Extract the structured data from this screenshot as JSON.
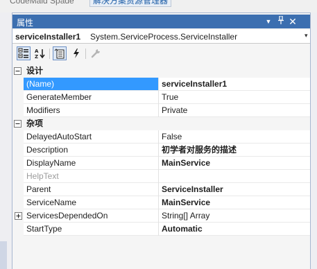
{
  "doc_tabs": [
    {
      "label": "CodeMaid Spade"
    },
    {
      "label": "解决方案资源管理器"
    }
  ],
  "panel": {
    "title": "属性",
    "buttons": {
      "dropdown": "▼",
      "pin": "ᚁ",
      "close": "✕"
    }
  },
  "selector": {
    "object_name": "serviceInstaller1",
    "object_type": "System.ServiceProcess.ServiceInstaller",
    "dropdown_glyph": "▾"
  },
  "toolbar": {
    "categorized": {
      "icon": "categorized-icon",
      "active": true
    },
    "alphabetical": {
      "icon": "alphabetical-sort-icon",
      "active": false
    },
    "properties": {
      "icon": "properties-icon",
      "active": true
    },
    "events": {
      "icon": "events-lightning-icon",
      "active": false
    },
    "property_pages": {
      "icon": "wrench-icon",
      "enabled": false
    }
  },
  "categories": [
    {
      "label": "设计",
      "expanded": true,
      "properties": [
        {
          "name": "(Name)",
          "value": "serviceInstaller1",
          "bold": true,
          "selected": true
        },
        {
          "name": "GenerateMember",
          "value": "True",
          "bold": false
        },
        {
          "name": "Modifiers",
          "value": "Private",
          "bold": false
        }
      ]
    },
    {
      "label": "杂项",
      "expanded": true,
      "properties": [
        {
          "name": "DelayedAutoStart",
          "value": "False",
          "bold": false
        },
        {
          "name": "Description",
          "value": "初学者对服务的描述",
          "bold": true
        },
        {
          "name": "DisplayName",
          "value": "MainService",
          "bold": true
        },
        {
          "name": "HelpText",
          "value": "",
          "bold": false,
          "disabled": true
        },
        {
          "name": "Parent",
          "value": "ServiceInstaller",
          "bold": true
        },
        {
          "name": "ServiceName",
          "value": "MainService",
          "bold": true
        },
        {
          "name": "ServicesDependedOn",
          "value": "String[] Array",
          "bold": false,
          "expandable": true
        },
        {
          "name": "StartType",
          "value": "Automatic",
          "bold": true
        }
      ]
    }
  ],
  "colors": {
    "title_bar": "#3c6fb0",
    "selection": "#3399ff",
    "disabled_text": "#9b9b9b"
  }
}
